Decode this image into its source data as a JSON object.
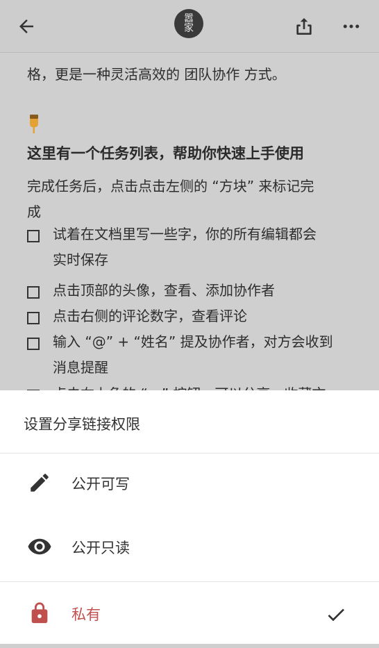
{
  "header": {
    "avatar_text_top": "嚣",
    "avatar_text_bottom": "家",
    "icons": [
      "back-arrow-icon",
      "share-upload-icon",
      "more-horiz-icon"
    ]
  },
  "document": {
    "intro_line": "格，更是一种灵活高效的 团队协作 方式。",
    "pointer_icon": "pointing-down-hand-icon",
    "heading": "这里有一个任务列表，帮助你快速上手使用",
    "desc_line1": "完成任务后，点击点击左侧的 “方块” 来标记完",
    "desc_line2": "成",
    "tasks": [
      {
        "line1": "试着在文档里写一些字，你的所有编辑都会",
        "line2": "实时保存"
      },
      {
        "line1": "点击顶部的头像，查看、添加协作者",
        "line2": ""
      },
      {
        "line1": "点击右侧的评论数字，查看评论",
        "line2": ""
      },
      {
        "line1": "输入 “@” + “姓名” 提及协作者，对方会收到",
        "line2": "消息提醒"
      },
      {
        "line1": "点击右上角的 “…” 按钮，可以分享、收藏文",
        "line2": ""
      }
    ]
  },
  "sheet": {
    "title": "设置分享链接权限",
    "options": [
      {
        "label": "公开可写",
        "icon": "pencil-icon"
      },
      {
        "label": "公开只读",
        "icon": "eye-icon"
      },
      {
        "label": "私有",
        "icon": "lock-icon",
        "selected": true
      }
    ],
    "colors": {
      "private": "#c0504d",
      "text": "#333333"
    }
  }
}
